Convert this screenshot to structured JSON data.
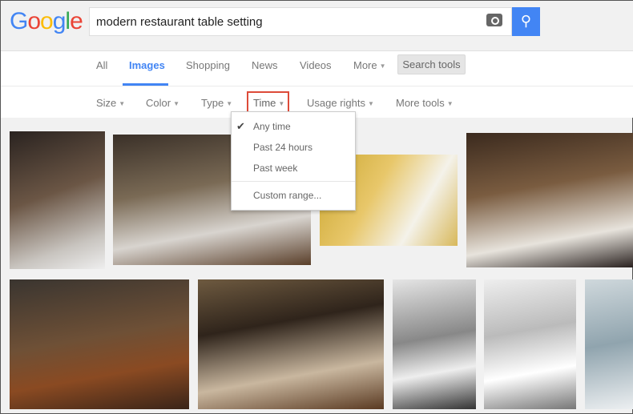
{
  "logo": "Google",
  "search": {
    "query": "modern restaurant table setting",
    "camera_icon": "camera-icon",
    "search_icon": "magnifier-icon"
  },
  "tabs": [
    {
      "label": "All"
    },
    {
      "label": "Images",
      "active": true
    },
    {
      "label": "Shopping"
    },
    {
      "label": "News"
    },
    {
      "label": "Videos"
    },
    {
      "label": "More"
    }
  ],
  "search_tools": "Search tools",
  "tools": [
    {
      "label": "Size"
    },
    {
      "label": "Color"
    },
    {
      "label": "Type"
    },
    {
      "label": "Time"
    },
    {
      "label": "Usage rights"
    },
    {
      "label": "More tools"
    }
  ],
  "time_menu": {
    "items": [
      "Any time",
      "Past 24 hours",
      "Past week",
      "Custom range..."
    ],
    "selected": "Any time"
  },
  "colors": {
    "accent": "#4285f4",
    "highlight": "#dd4b39"
  }
}
